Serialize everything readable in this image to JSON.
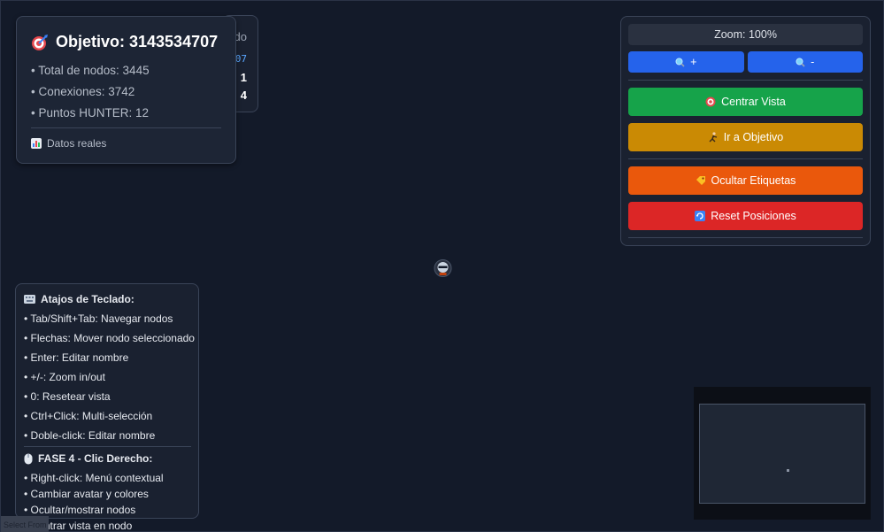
{
  "back_panel": {
    "label": "do",
    "id_value": "07",
    "count_a": "1",
    "count_b": "4"
  },
  "objective": {
    "title": "Objetivo: 3143534707",
    "total_nodes": "• Total de nodos: 3445",
    "connections": "• Conexiones: 3742",
    "hunter_points": "• Puntos HUNTER: 12",
    "footer": "Datos reales",
    "icon": "target-icon"
  },
  "controls": {
    "zoom_label": "Zoom: 100%",
    "zoom_in_label": "+",
    "zoom_out_label": "-",
    "center_view_label": "Centrar Vista",
    "go_to_target_label": "Ir a Objetivo",
    "hide_labels_label": "Ocultar Etiquetas",
    "reset_positions_label": "Reset Posiciones",
    "colors": {
      "zoom": "#2563eb",
      "center": "#16a34a",
      "target": "#ca8a04",
      "labels": "#ea580c",
      "reset": "#dc2626"
    }
  },
  "shortcuts": {
    "heading": "Atajos de Teclado:",
    "items": [
      "• Tab/Shift+Tab: Navegar nodos",
      "• Flechas: Mover nodo seleccionado",
      "• Enter: Editar nombre",
      "• +/-: Zoom in/out",
      "• 0: Resetear vista",
      "• Ctrl+Click: Multi-selección",
      "• Doble-click: Editar nombre"
    ],
    "phase_heading": "FASE 4 - Clic Derecho:",
    "phase_items": [
      "• Right-click: Menú contextual",
      "• Cambiar avatar y colores",
      "• Ocultar/mostrar nodos",
      "• Centrar vista en nodo"
    ]
  },
  "corner_label": "Select From"
}
